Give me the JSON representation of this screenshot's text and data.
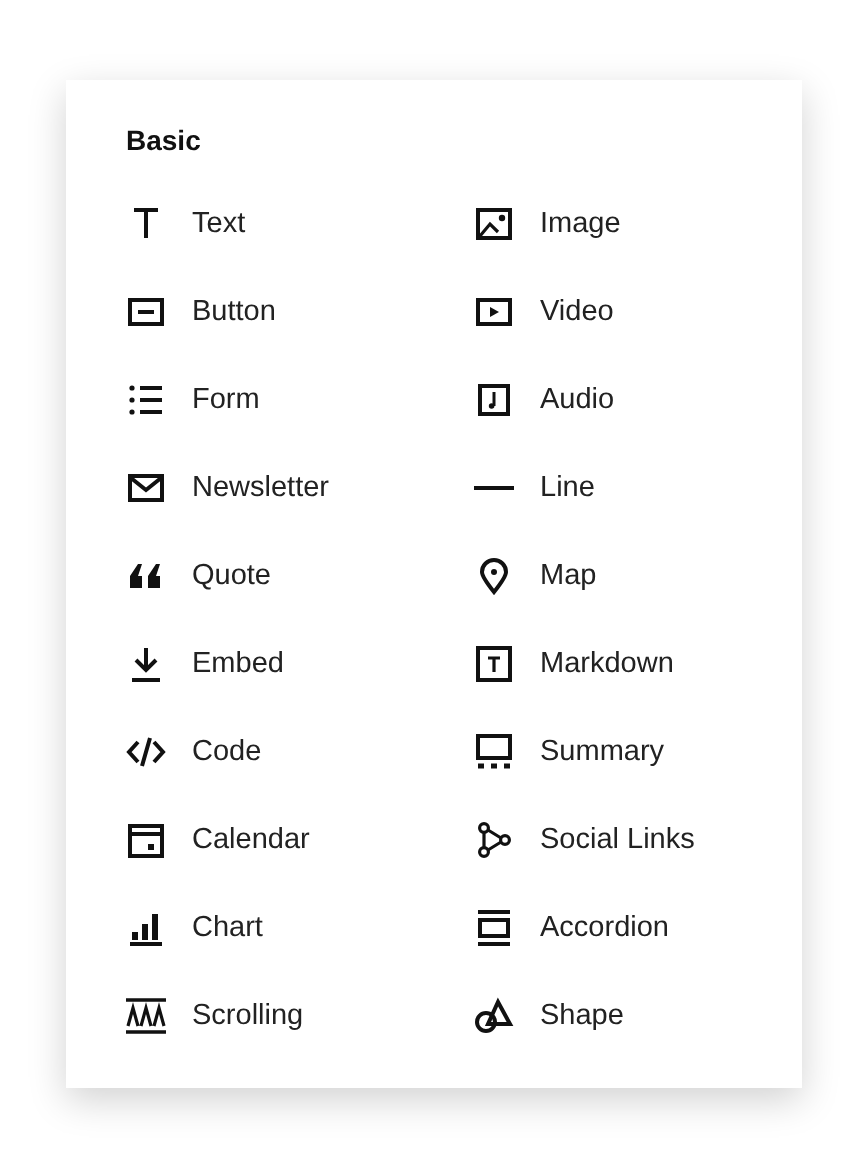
{
  "panel": {
    "heading": "Basic",
    "items": [
      {
        "kind": "text",
        "label": "Text"
      },
      {
        "kind": "image",
        "label": "Image"
      },
      {
        "kind": "button",
        "label": "Button"
      },
      {
        "kind": "video",
        "label": "Video"
      },
      {
        "kind": "form",
        "label": "Form"
      },
      {
        "kind": "audio",
        "label": "Audio"
      },
      {
        "kind": "newsletter",
        "label": "Newsletter"
      },
      {
        "kind": "line",
        "label": "Line"
      },
      {
        "kind": "quote",
        "label": "Quote"
      },
      {
        "kind": "map",
        "label": "Map"
      },
      {
        "kind": "embed",
        "label": "Embed"
      },
      {
        "kind": "markdown",
        "label": "Markdown"
      },
      {
        "kind": "code",
        "label": "Code"
      },
      {
        "kind": "summary",
        "label": "Summary"
      },
      {
        "kind": "calendar",
        "label": "Calendar"
      },
      {
        "kind": "social",
        "label": "Social Links"
      },
      {
        "kind": "chart",
        "label": "Chart"
      },
      {
        "kind": "accordion",
        "label": "Accordion"
      },
      {
        "kind": "scrolling",
        "label": "Scrolling"
      },
      {
        "kind": "shape",
        "label": "Shape"
      }
    ]
  }
}
